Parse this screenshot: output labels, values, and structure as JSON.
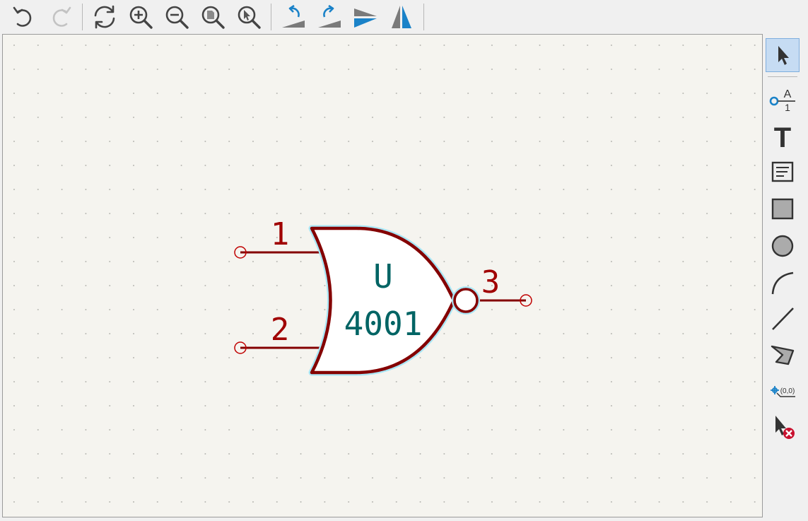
{
  "toolbar": {
    "buttons": [
      {
        "name": "undo-button",
        "icon": "undo-icon",
        "enabled": true
      },
      {
        "name": "redo-button",
        "icon": "redo-icon",
        "enabled": false
      },
      {
        "name": "refresh-button",
        "icon": "refresh-icon",
        "enabled": true
      },
      {
        "name": "zoom-in-button",
        "icon": "zoom-in-icon",
        "enabled": true
      },
      {
        "name": "zoom-out-button",
        "icon": "zoom-out-icon",
        "enabled": true
      },
      {
        "name": "zoom-fit-page-button",
        "icon": "zoom-fit-page-icon",
        "enabled": true
      },
      {
        "name": "zoom-to-objects-button",
        "icon": "zoom-objects-icon",
        "enabled": true
      },
      {
        "name": "rotate-ccw-button",
        "icon": "rotate-ccw-icon",
        "enabled": true
      },
      {
        "name": "rotate-cw-button",
        "icon": "rotate-cw-icon",
        "enabled": true
      },
      {
        "name": "mirror-vertical-button",
        "icon": "mirror-vertical-icon",
        "enabled": true
      },
      {
        "name": "mirror-horizontal-button",
        "icon": "mirror-horizontal-icon",
        "enabled": true
      }
    ]
  },
  "side_toolbar": {
    "tools": [
      {
        "name": "select-tool",
        "icon": "cursor-icon",
        "active": true
      },
      {
        "name": "add-pin-tool",
        "icon": "pin-icon",
        "label_top": "A",
        "label_bottom": "1"
      },
      {
        "name": "add-text-tool",
        "icon": "text-icon",
        "label": "T"
      },
      {
        "name": "add-textbox-tool",
        "icon": "textbox-icon"
      },
      {
        "name": "add-rectangle-tool",
        "icon": "rectangle-icon"
      },
      {
        "name": "add-circle-tool",
        "icon": "circle-icon"
      },
      {
        "name": "add-arc-tool",
        "icon": "arc-icon"
      },
      {
        "name": "add-line-tool",
        "icon": "line-icon"
      },
      {
        "name": "add-polygon-tool",
        "icon": "polygon-icon"
      },
      {
        "name": "anchor-tool",
        "icon": "anchor-icon",
        "label": "(0,0)"
      },
      {
        "name": "delete-tool",
        "icon": "delete-cursor-icon"
      }
    ]
  },
  "symbol": {
    "reference": "U",
    "value": "4001",
    "pins": [
      {
        "number": "1"
      },
      {
        "number": "2"
      },
      {
        "number": "3"
      }
    ],
    "body_outline_color": "#840000",
    "body_fill_color": "#ffffff",
    "body_halo_color": "#a8e6f5",
    "field_text_color": "#006464",
    "pin_number_color": "#a00000",
    "pin_endpoint_color": "#c00000"
  },
  "colors": {
    "canvas_background": "#f5f4ef",
    "toolbar_background": "#f0f0f0",
    "accent_blue": "#1a82c8",
    "active_tool_background": "#c6dcf3"
  }
}
